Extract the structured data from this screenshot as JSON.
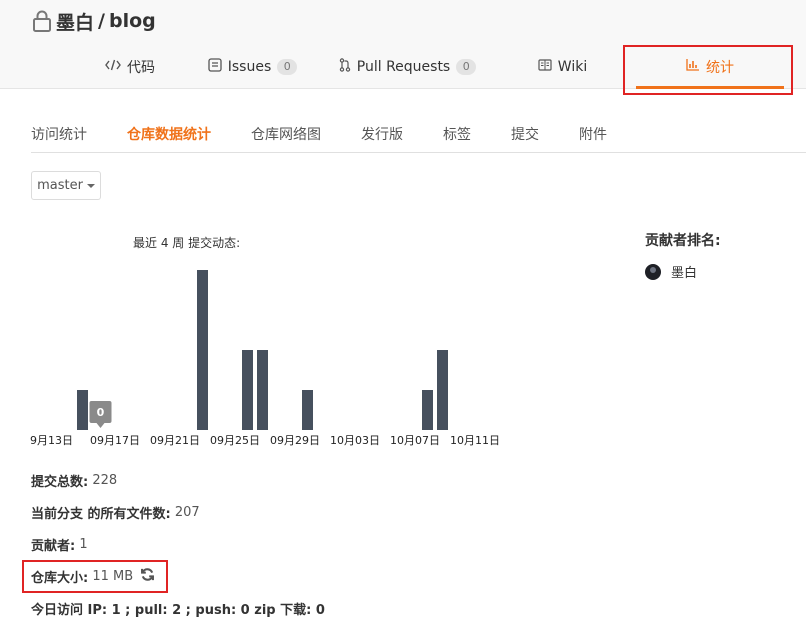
{
  "repo": {
    "owner": "墨白",
    "separator": "/",
    "name": "blog"
  },
  "tabs": [
    {
      "label": "代码",
      "icon": "code-icon"
    },
    {
      "label": "Issues",
      "count": "0",
      "icon": "issues-icon"
    },
    {
      "label": "Pull Requests",
      "count": "0",
      "icon": "pull-request-icon"
    },
    {
      "label": "Wiki",
      "icon": "wiki-icon"
    },
    {
      "label": "统计",
      "icon": "bar-chart-icon",
      "active": true
    }
  ],
  "subnav": [
    "访问统计",
    "仓库数据统计",
    "仓库网络图",
    "发行版",
    "标签",
    "提交",
    "附件"
  ],
  "subnav_active": "仓库数据统计",
  "branch": {
    "selected": "master"
  },
  "chart_title": "最近 4 周 提交动态:",
  "chart_data": {
    "type": "bar",
    "title": "最近 4 周 提交动态:",
    "x_tick_labels": [
      "9月13日",
      "09月17日",
      "09月21日",
      "09月25日",
      "09月29日",
      "10月03日",
      "10月07日",
      "10月11日"
    ],
    "x": [
      "09-13",
      "09-14",
      "09-15",
      "09-16",
      "09-17",
      "09-18",
      "09-19",
      "09-20",
      "09-21",
      "09-22",
      "09-23",
      "09-24",
      "09-25",
      "09-26",
      "09-27",
      "09-28",
      "09-29",
      "09-30",
      "10-01",
      "10-02",
      "10-03",
      "10-04",
      "10-05",
      "10-06",
      "10-07",
      "10-08",
      "10-09",
      "10-10",
      "10-11"
    ],
    "values": [
      0,
      0,
      0,
      1,
      0,
      0,
      0,
      0,
      0,
      0,
      0,
      4,
      0,
      0,
      2,
      2,
      0,
      0,
      1,
      0,
      0,
      0,
      0,
      0,
      0,
      0,
      1,
      2,
      0
    ],
    "tooltip": {
      "x": "09-17",
      "value": "0"
    },
    "ylim": [
      0,
      4
    ],
    "grid": false,
    "bar_color": "#46505e"
  },
  "contributors": {
    "title": "贡献者排名:",
    "items": [
      {
        "name": "墨白"
      }
    ]
  },
  "stats": [
    {
      "label": "提交总数:",
      "value": "228"
    },
    {
      "label": "当前分支 的所有文件数:",
      "value": "207"
    },
    {
      "label": "贡献者:",
      "value": "1"
    },
    {
      "label": "仓库大小:",
      "value": "11 MB"
    },
    {
      "label": "今日访问 IP: 1 ; pull: 2 ; push: 0 zip 下载: 0",
      "value": ""
    }
  ],
  "colors": {
    "accent": "#f0721a",
    "highlight_box": "#e02424",
    "bar": "#46505e"
  }
}
